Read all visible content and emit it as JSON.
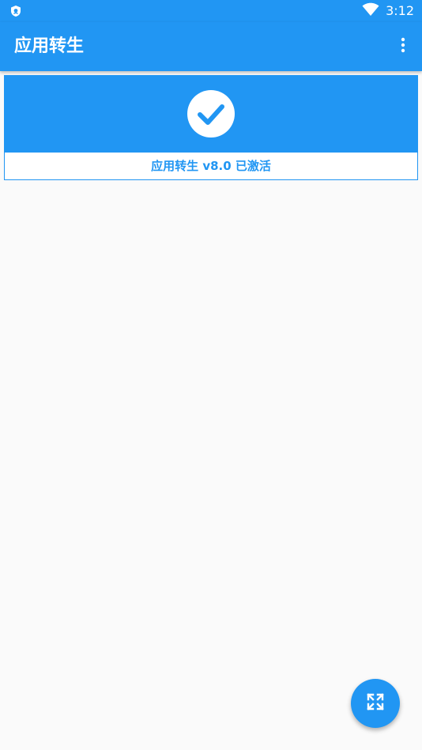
{
  "status_bar": {
    "time": "3:12",
    "left_icon": "shield-icon",
    "right_icon": "wifi-icon"
  },
  "app_bar": {
    "title": "应用转生",
    "menu_icon": "more-vert-icon"
  },
  "status_card": {
    "icon": "check-circle-icon",
    "label": "应用转生 v8.0 已激活"
  },
  "fab": {
    "icon": "expand-icon"
  },
  "colors": {
    "primary": "#2196f3",
    "background": "#fafafa",
    "card": "#ffffff"
  }
}
